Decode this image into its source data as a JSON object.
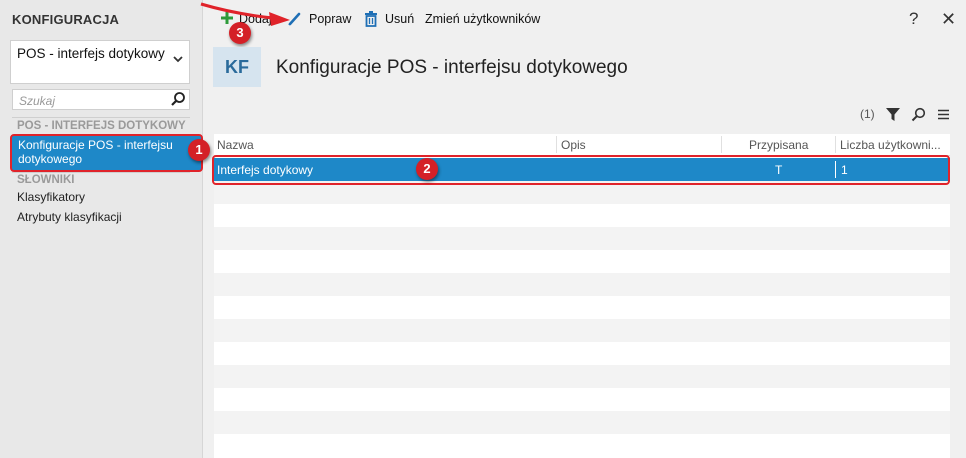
{
  "sidebar": {
    "title": "KONFIGURACJA",
    "module_select": "POS - interfejs dotykowy",
    "search_placeholder": "Szukaj",
    "group1": "POS - INTERFEJS DOTYKOWY",
    "active_item": "Konfiguracje POS - interfejsu dotykowego",
    "group2": "SŁOWNIKI",
    "items": [
      "Klasyfikatory",
      "Atrybuty klasyfikacji"
    ]
  },
  "toolbar": {
    "add": "Dodaj",
    "edit": "Popraw",
    "delete": "Usuń",
    "change_users": "Zmień użytkowników",
    "help": "?",
    "close": "✕"
  },
  "header": {
    "badge": "KF",
    "title": "Konfiguracje POS - interfejsu dotykowego"
  },
  "filter": {
    "count": "(1)"
  },
  "grid": {
    "columns": [
      "Nazwa",
      "Opis",
      "Przypisana",
      "Liczba użytkowni..."
    ],
    "rows": [
      {
        "name": "Interfejs dotykowy",
        "description": "",
        "assigned": "T",
        "users": "1"
      }
    ]
  },
  "annotations": [
    "1",
    "2",
    "3"
  ],
  "colors": {
    "selection": "#1e88c8",
    "annotation": "#e0232a",
    "add_icon": "#2e9b3a",
    "edit_icon": "#1f6fb5",
    "delete_icon": "#1f6fb5"
  }
}
